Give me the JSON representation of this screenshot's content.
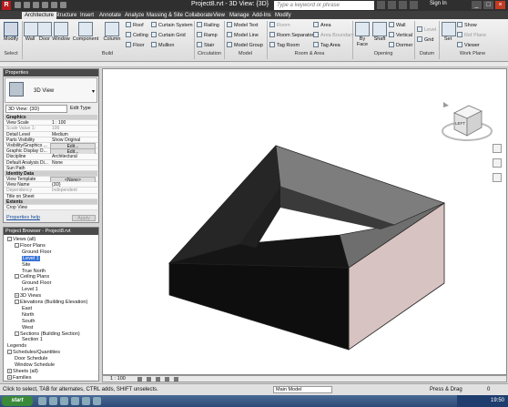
{
  "titlebar": {
    "logo": "R",
    "title": "Project8.rvt - 3D View: {3D}",
    "search_placeholder": "Type a keyword or phrase",
    "signin": "Sign In"
  },
  "tabs": [
    "Architecture",
    "Structure",
    "Insert",
    "Annotate",
    "Analyze",
    "Massing & Site",
    "Collaborate",
    "View",
    "Manage",
    "Add-Ins",
    "Modify"
  ],
  "ribbon": {
    "modify": "Modify",
    "select_label": "Select",
    "build": {
      "label": "Build",
      "big": [
        "Wall",
        "Door",
        "Window",
        "Component",
        "Column"
      ],
      "small": [
        "Roof",
        "Ceiling",
        "Floor",
        "Curtain System",
        "Curtain Grid",
        "Mullion"
      ]
    },
    "circulation": {
      "label": "Circulation",
      "items": [
        "Railing",
        "Ramp",
        "Stair"
      ]
    },
    "model": {
      "label": "Model",
      "items": [
        "Model Text",
        "Model Line",
        "Model Group"
      ]
    },
    "room_area": {
      "label": "Room & Area",
      "items": [
        "Room",
        "Room Separator",
        "Tag Room",
        "Area",
        "Area Boundary",
        "Tag Area"
      ]
    },
    "opening": {
      "label": "Opening",
      "big": [
        "By Face",
        "Shaft"
      ],
      "small": [
        "Wall",
        "Vertical",
        "Dormer"
      ]
    },
    "datum": {
      "label": "Datum",
      "items": [
        "Level",
        "Grid"
      ]
    },
    "work_plane": {
      "label": "Work Plane",
      "big": "Set",
      "items": [
        "Show",
        "Ref Plane",
        "Viewer"
      ]
    }
  },
  "properties": {
    "header": "Properties",
    "type_name": "3D View",
    "instance_selector": "3D View: {3D}",
    "edit_type": "Edit Type",
    "rows": [
      {
        "k": "Graphics",
        "v": "",
        "group": true
      },
      {
        "k": "View Scale",
        "v": "1 : 100"
      },
      {
        "k": "Scale Value    1:",
        "v": "100",
        "dim": true
      },
      {
        "k": "Detail Level",
        "v": "Medium"
      },
      {
        "k": "Parts Visibility",
        "v": "Show Original"
      },
      {
        "k": "Visibility/Graphics ...",
        "v": "Edit...",
        "btn": true
      },
      {
        "k": "Graphic Display O...",
        "v": "Edit...",
        "btn": true
      },
      {
        "k": "Discipline",
        "v": "Architectural"
      },
      {
        "k": "Default Analysis Di...",
        "v": "None"
      },
      {
        "k": "Sun Path",
        "v": ""
      },
      {
        "k": "Identity Data",
        "v": "",
        "group": true
      },
      {
        "k": "View Template",
        "v": "<None>",
        "btn": true
      },
      {
        "k": "View Name",
        "v": "{3D}"
      },
      {
        "k": "Dependency",
        "v": "Independent",
        "dim": true
      },
      {
        "k": "Title on Sheet",
        "v": ""
      },
      {
        "k": "Extents",
        "v": "",
        "group": true
      },
      {
        "k": "Crop View",
        "v": ""
      }
    ],
    "help": "Properties help",
    "apply": "Apply"
  },
  "browser": {
    "header": "Project Browser - Project8.rvt",
    "nodes": [
      {
        "label": "Views (all)",
        "level": 0,
        "toggle": "-"
      },
      {
        "label": "Floor Plans",
        "level": 1,
        "toggle": "-"
      },
      {
        "label": "Ground Floor",
        "level": 2
      },
      {
        "label": "Level 1",
        "level": 2,
        "selected": true
      },
      {
        "label": "Site",
        "level": 2
      },
      {
        "label": "True North",
        "level": 2
      },
      {
        "label": "Ceiling Plans",
        "level": 1,
        "toggle": "-"
      },
      {
        "label": "Ground Floor",
        "level": 2
      },
      {
        "label": "Level 1",
        "level": 2
      },
      {
        "label": "3D Views",
        "level": 1,
        "toggle": "+"
      },
      {
        "label": "Elevations (Building Elevation)",
        "level": 1,
        "toggle": "-"
      },
      {
        "label": "East",
        "level": 2
      },
      {
        "label": "North",
        "level": 2
      },
      {
        "label": "South",
        "level": 2
      },
      {
        "label": "West",
        "level": 2
      },
      {
        "label": "Sections (Building Section)",
        "level": 1,
        "toggle": "-"
      },
      {
        "label": "Section 1",
        "level": 2
      },
      {
        "label": "Legends",
        "level": 0
      },
      {
        "label": "Schedules/Quantities",
        "level": 0,
        "toggle": "-"
      },
      {
        "label": "Door Schedule",
        "level": 1
      },
      {
        "label": "Window Schedule",
        "level": 1
      },
      {
        "label": "Sheets (all)",
        "level": 0,
        "toggle": "+"
      },
      {
        "label": "Families",
        "level": 0,
        "toggle": "+"
      }
    ]
  },
  "viewcube": {
    "face_label": "LEFT"
  },
  "view_control": {
    "scale": "1 : 100"
  },
  "status": {
    "text": "Click to select, TAB for alternates, CTRL adds, SHIFT unselects.",
    "model": "Main Model",
    "press_drag": "Press & Drag",
    "filter": "0"
  },
  "taskbar": {
    "start": "start",
    "clock": "19:50"
  },
  "colors": {
    "roof_top": "#5a5a5a",
    "wall_front": "#0e0e0e",
    "wall_side": "#d7c3c1",
    "selection": "#3874d8"
  }
}
